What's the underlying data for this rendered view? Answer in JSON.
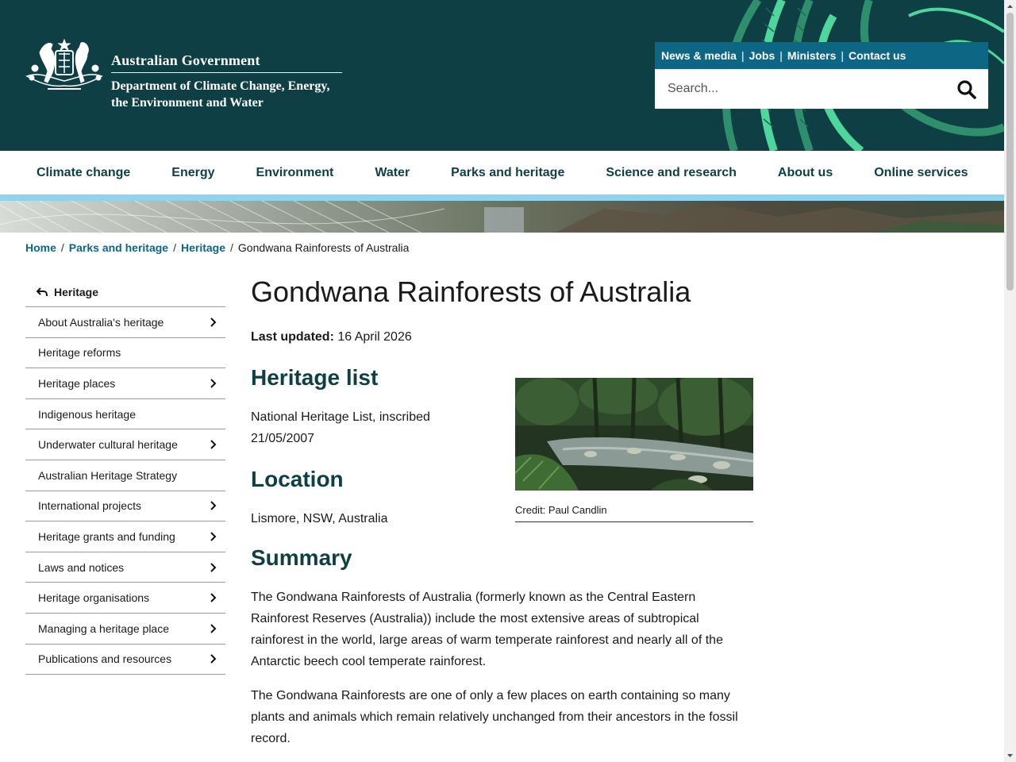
{
  "header": {
    "gov_title": "Australian Government",
    "dept_line1": "Department of Climate Change, Energy,",
    "dept_line2": "the Environment and Water"
  },
  "utility_links": [
    "News & media",
    "Jobs",
    "Ministers",
    "Contact us"
  ],
  "search": {
    "placeholder": "Search..."
  },
  "main_nav": [
    "Climate change",
    "Energy",
    "Environment",
    "Water",
    "Parks and heritage",
    "Science and research",
    "About us",
    "Online services"
  ],
  "breadcrumb": {
    "items": [
      "Home",
      "Parks and heritage",
      "Heritage"
    ],
    "current": "Gondwana Rainforests of Australia"
  },
  "sidebar": {
    "parent": "Heritage",
    "items": [
      {
        "label": "About Australia's heritage",
        "has_children": true
      },
      {
        "label": "Heritage reforms",
        "has_children": false
      },
      {
        "label": "Heritage places",
        "has_children": true
      },
      {
        "label": "Indigenous heritage",
        "has_children": false
      },
      {
        "label": "Underwater cultural heritage",
        "has_children": true
      },
      {
        "label": "Australian Heritage Strategy",
        "has_children": false
      },
      {
        "label": "International projects",
        "has_children": true
      },
      {
        "label": "Heritage grants and funding",
        "has_children": true
      },
      {
        "label": "Laws and notices",
        "has_children": true
      },
      {
        "label": "Heritage organisations",
        "has_children": true
      },
      {
        "label": "Managing a heritage place",
        "has_children": true
      },
      {
        "label": "Publications and resources",
        "has_children": true
      }
    ]
  },
  "page": {
    "title": "Gondwana Rainforests of Australia",
    "last_updated_label": "Last updated:",
    "last_updated_value": "16 April 2026",
    "heritage_list_heading": "Heritage list",
    "heritage_list_text": "National Heritage List, inscribed 21/05/2007",
    "location_heading": "Location",
    "location_text": "Lismore, NSW, Australia",
    "summary_heading": "Summary",
    "summary_p1": "The Gondwana Rainforests of Australia (formerly known as the Central Eastern Rainforest Reserves (Australia)) include the most extensive areas of subtropical rainforest in the world, large areas of warm temperate rainforest and nearly all of the Antarctic beech cool temperate rainforest.",
    "summary_p2": "The Gondwana Rainforests are one of only a few places on earth containing so many plants and animals which remain relatively unchanged from their ancestors in the fossil record.",
    "image_credit": "Credit: Paul Candlin"
  },
  "colors": {
    "header_bg": "#0e3f44",
    "util_bar": "#0d6684",
    "nav_accent": "#8fd3ee",
    "link": "#0d6684",
    "heading": "#0e3f44"
  }
}
